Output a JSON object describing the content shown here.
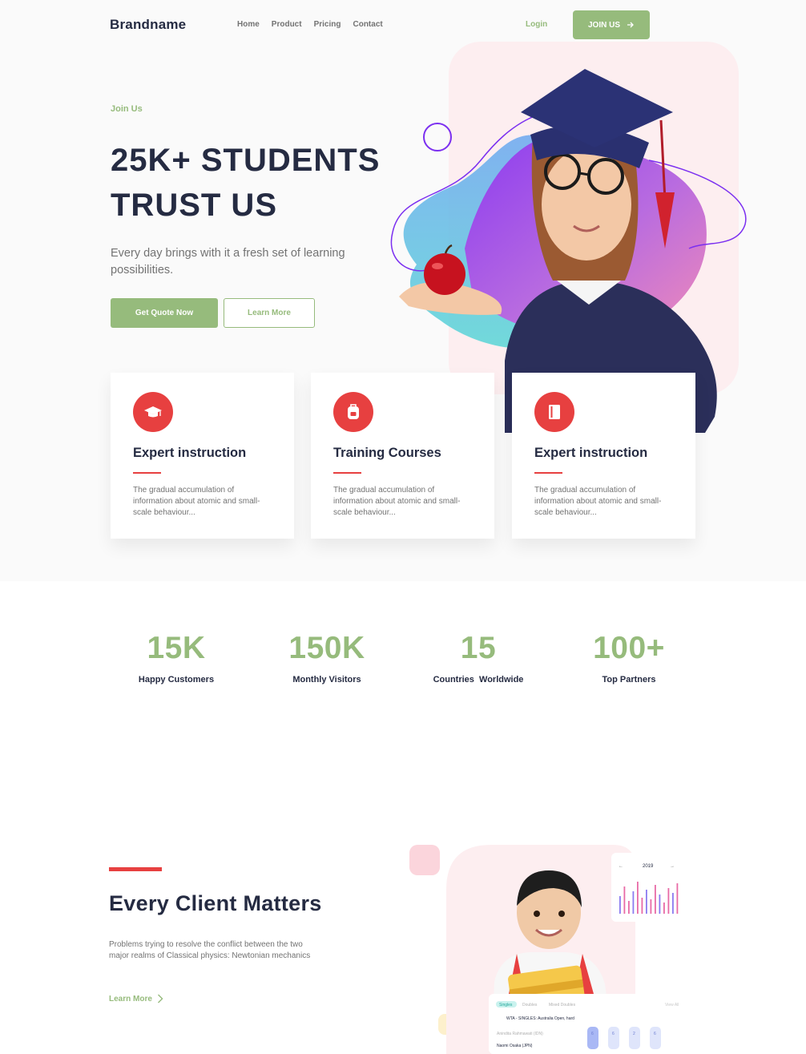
{
  "navbar": {
    "brand": "Brandname",
    "links": [
      "Home",
      "Product",
      "Pricing",
      "Contact"
    ],
    "login": "Login",
    "join": "JOIN US"
  },
  "hero": {
    "eyebrow": "Join Us",
    "title_line1": "25K+ STUDENTS",
    "title_line2": "TRUST US",
    "description": "Every day brings with it a fresh set of learning possibilities.",
    "primary_button": "Get Quote Now",
    "secondary_button": "Learn More"
  },
  "features": [
    {
      "icon": "graduation-cap-icon",
      "title": "Expert instruction",
      "text": "The gradual accumulation of information about atomic and small-scale behaviour..."
    },
    {
      "icon": "backpack-icon",
      "title": "Training Courses",
      "text": "The gradual accumulation of information about atomic and small-scale behaviour..."
    },
    {
      "icon": "book-icon",
      "title": "Expert instruction",
      "text": "The gradual accumulation of information about atomic and small-scale behaviour..."
    }
  ],
  "stats": [
    {
      "value": "15K",
      "label": "Happy Customers"
    },
    {
      "value": "150K",
      "label": "Monthly Visitors"
    },
    {
      "value": "15",
      "label": "Countries  Worldwide"
    },
    {
      "value": "100+",
      "label": "Top Partners"
    }
  ],
  "client": {
    "title": "Every Client Matters",
    "description": "Problems trying to resolve the conflict between the two major realms of Classical physics: Newtonian mechanics",
    "link": "Learn More"
  },
  "mini_chart": {
    "year": "2019",
    "prev": "←",
    "next": "→"
  },
  "mini_table": {
    "tabs": [
      "Singles",
      "Doubles",
      "Mixed Doubles"
    ],
    "view_all": "View All",
    "event": "WTA - SINGLES: Australia Open, hard",
    "rows": [
      "Anindita Rahmawati (IDN)",
      "Naomi Osaka (JPN)"
    ],
    "scores": [
      "6",
      "6",
      "2",
      "6"
    ]
  },
  "colors": {
    "primary": "#96bb7c",
    "accent": "#e74040",
    "heading": "#252b42",
    "muted": "#737373"
  }
}
